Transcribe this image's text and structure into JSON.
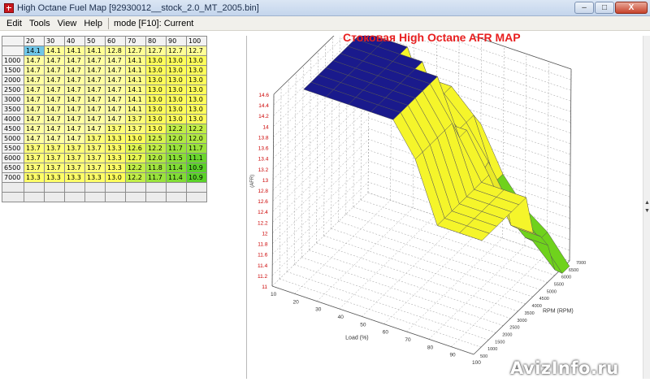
{
  "window": {
    "title": "High Octane Fuel Map [92930012__stock_2.0_MT_2005.bin]",
    "buttons": {
      "minimize": "–",
      "maximize": "□",
      "close": "X"
    }
  },
  "menu": {
    "items": [
      "Edit",
      "Tools",
      "View",
      "Help"
    ],
    "mode": "mode [F10]: Current"
  },
  "table": {
    "columns": [
      "20",
      "30",
      "40",
      "50",
      "60",
      "70",
      "80",
      "90",
      "100"
    ],
    "rows": [
      {
        "rpm": "",
        "values": [
          "14.1",
          "14.1",
          "14.1",
          "14.1",
          "12.8",
          "12.7",
          "12.7",
          "12.7",
          "12.7"
        ]
      },
      {
        "rpm": "1000",
        "values": [
          "14.7",
          "14.7",
          "14.7",
          "14.7",
          "14.7",
          "14.1",
          "13.0",
          "13.0",
          "13.0"
        ]
      },
      {
        "rpm": "1500",
        "values": [
          "14.7",
          "14.7",
          "14.7",
          "14.7",
          "14.7",
          "14.1",
          "13.0",
          "13.0",
          "13.0"
        ]
      },
      {
        "rpm": "2000",
        "values": [
          "14.7",
          "14.7",
          "14.7",
          "14.7",
          "14.7",
          "14.1",
          "13.0",
          "13.0",
          "13.0"
        ]
      },
      {
        "rpm": "2500",
        "values": [
          "14.7",
          "14.7",
          "14.7",
          "14.7",
          "14.7",
          "14.1",
          "13.0",
          "13.0",
          "13.0"
        ]
      },
      {
        "rpm": "3000",
        "values": [
          "14.7",
          "14.7",
          "14.7",
          "14.7",
          "14.7",
          "14.1",
          "13.0",
          "13.0",
          "13.0"
        ]
      },
      {
        "rpm": "3500",
        "values": [
          "14.7",
          "14.7",
          "14.7",
          "14.7",
          "14.7",
          "14.1",
          "13.0",
          "13.0",
          "13.0"
        ]
      },
      {
        "rpm": "4000",
        "values": [
          "14.7",
          "14.7",
          "14.7",
          "14.7",
          "14.7",
          "13.7",
          "13.0",
          "13.0",
          "13.0"
        ]
      },
      {
        "rpm": "4500",
        "values": [
          "14.7",
          "14.7",
          "14.7",
          "14.7",
          "13.7",
          "13.7",
          "13.0",
          "12.2",
          "12.2"
        ]
      },
      {
        "rpm": "5000",
        "values": [
          "14.7",
          "14.7",
          "14.7",
          "13.7",
          "13.3",
          "13.0",
          "12.5",
          "12.0",
          "12.0"
        ]
      },
      {
        "rpm": "5500",
        "values": [
          "13.7",
          "13.7",
          "13.7",
          "13.7",
          "13.3",
          "12.6",
          "12.2",
          "11.7",
          "11.7"
        ]
      },
      {
        "rpm": "6000",
        "values": [
          "13.7",
          "13.7",
          "13.7",
          "13.7",
          "13.3",
          "12.7",
          "12.0",
          "11.5",
          "11.1"
        ]
      },
      {
        "rpm": "6500",
        "values": [
          "13.7",
          "13.7",
          "13.7",
          "13.7",
          "13.3",
          "12.2",
          "11.8",
          "11.4",
          "10.9"
        ]
      },
      {
        "rpm": "7000",
        "values": [
          "13.3",
          "13.3",
          "13.3",
          "13.3",
          "13.0",
          "12.2",
          "11.7",
          "11.4",
          "10.9"
        ]
      }
    ]
  },
  "chart": {
    "title": "Стоковая High Octane AFR MAP",
    "zlabel": "(AFR)",
    "xlabel": "Load (%)",
    "ylabel": "RPM (RPM)",
    "ztick_labels": [
      "14.6",
      "14.4",
      "14.2",
      "14",
      "13.8",
      "13.6",
      "13.4",
      "13.2",
      "13",
      "12.8",
      "12.6",
      "12.4",
      "12.2",
      "12",
      "11.8",
      "11.6",
      "11.4",
      "11.2",
      "11"
    ],
    "xtick_labels": [
      "10",
      "20",
      "30",
      "40",
      "50",
      "60",
      "70",
      "80",
      "90",
      "100"
    ],
    "ytick_labels": [
      "500",
      "1000",
      "1500",
      "2000",
      "2500",
      "3000",
      "3500",
      "4000",
      "4500",
      "5000",
      "5500",
      "6000",
      "6500",
      "7000"
    ]
  },
  "chart_data": {
    "type": "surface3d",
    "title": "Стоковая High Octane AFR MAP",
    "xlabel": "Load (%)",
    "ylabel": "RPM (RPM)",
    "zlabel": "(AFR)",
    "x": [
      20,
      30,
      40,
      50,
      60,
      70,
      80,
      90,
      100
    ],
    "y": [
      1000,
      1500,
      2000,
      2500,
      3000,
      3500,
      4000,
      4500,
      5000,
      5500,
      6000,
      6500,
      7000
    ],
    "zlim": [
      11,
      14.6
    ],
    "colors": {
      "low": "#6fd21c",
      "mid": "#e9e927",
      "high": "#f5f52a",
      "max": "#1a1a8c"
    }
  },
  "colors": {
    "title_red": "#e82020",
    "selected_cell": "#6ec6e8"
  },
  "watermark": "AvizInfo.ru"
}
